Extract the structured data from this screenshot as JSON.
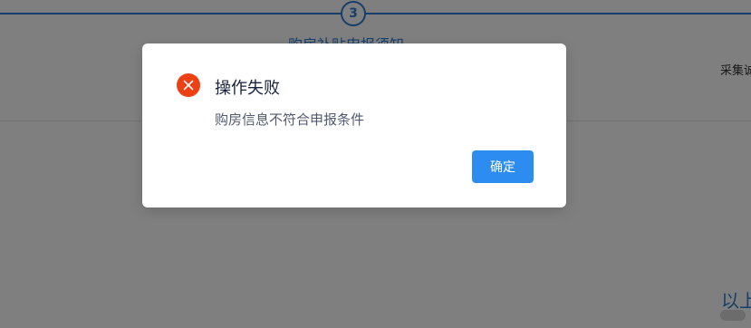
{
  "background": {
    "step_number": "3",
    "step_label": "购房补贴申报须知",
    "side_text": "采集诚",
    "corner_text": "以上"
  },
  "dialog": {
    "icon": "error-circle-icon",
    "title": "操作失败",
    "message": "购房信息不符合申报条件",
    "ok_label": "确定"
  },
  "colors": {
    "primary": "#2d8cf0",
    "error": "#ed4014",
    "overlay": "rgba(0,0,0,0.5)"
  }
}
